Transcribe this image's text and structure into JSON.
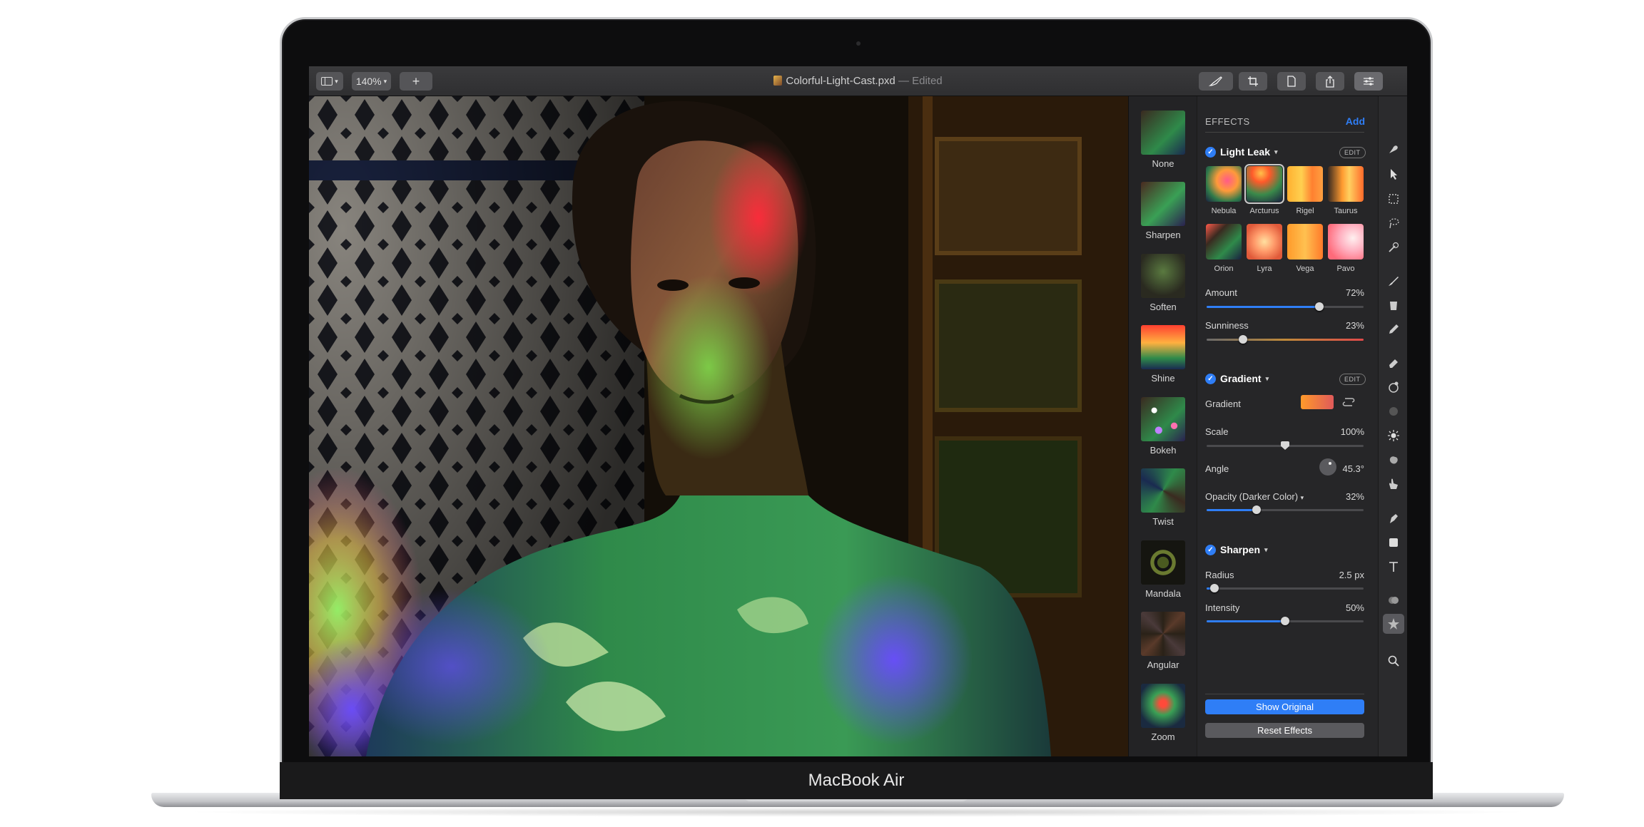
{
  "window": {
    "title": "Colorful-Light-Cast.pxd",
    "edited_suffix": "— Edited",
    "zoom": "140%",
    "device_label": "MacBook Air"
  },
  "toolbar": {
    "sidebar_icon": "sidebar-icon",
    "add_icon": "plus-icon",
    "right_icons": [
      "brush-icon",
      "crop-icon",
      "document-icon",
      "share-icon",
      "sliders-icon"
    ]
  },
  "presets": [
    {
      "label": "None"
    },
    {
      "label": "Sharpen"
    },
    {
      "label": "Soften"
    },
    {
      "label": "Shine"
    },
    {
      "label": "Bokeh"
    },
    {
      "label": "Twist"
    },
    {
      "label": "Mandala"
    },
    {
      "label": "Angular"
    },
    {
      "label": "Zoom"
    }
  ],
  "effects": {
    "header": "EFFECTS",
    "add": "Add",
    "light_leak": {
      "title": "Light Leak",
      "edit": "EDIT",
      "styles": [
        "Nebula",
        "Arcturus",
        "Rigel",
        "Taurus",
        "Orion",
        "Lyra",
        "Vega",
        "Pavo"
      ],
      "selected": "Arcturus",
      "amount_label": "Amount",
      "amount_value": "72%",
      "amount": 0.72,
      "sunniness_label": "Sunniness",
      "sunniness_value": "23%",
      "sunniness": 0.23
    },
    "gradient": {
      "title": "Gradient",
      "edit": "EDIT",
      "gradient_label": "Gradient",
      "scale_label": "Scale",
      "scale_value": "100%",
      "scale": 0.5,
      "angle_label": "Angle",
      "angle_value": "45.3°",
      "opacity_label": "Opacity (Darker Color)",
      "opacity_value": "32%",
      "opacity": 0.32
    },
    "sharpen": {
      "title": "Sharpen",
      "radius_label": "Radius",
      "radius_value": "2.5 px",
      "radius": 0.05,
      "intensity_label": "Intensity",
      "intensity_value": "50%",
      "intensity": 0.5
    },
    "show_original": "Show Original",
    "reset_effects": "Reset Effects"
  },
  "colors": {
    "accent": "#2f7ef6",
    "panel_bg": "#262628",
    "toolbar_bg": "#353537"
  },
  "tools": [
    "smudge-icon",
    "pointer-icon",
    "marquee-icon",
    "lasso-icon",
    "magic-wand-icon",
    "brush-icon",
    "bucket-icon",
    "pencil-icon",
    "eraser-icon",
    "clone-icon",
    "blur-icon",
    "light-icon",
    "sponge-icon",
    "finger-icon",
    "pen-icon",
    "shape-icon",
    "text-icon",
    "color-picker-icon",
    "effects-icon",
    "zoom-icon"
  ]
}
